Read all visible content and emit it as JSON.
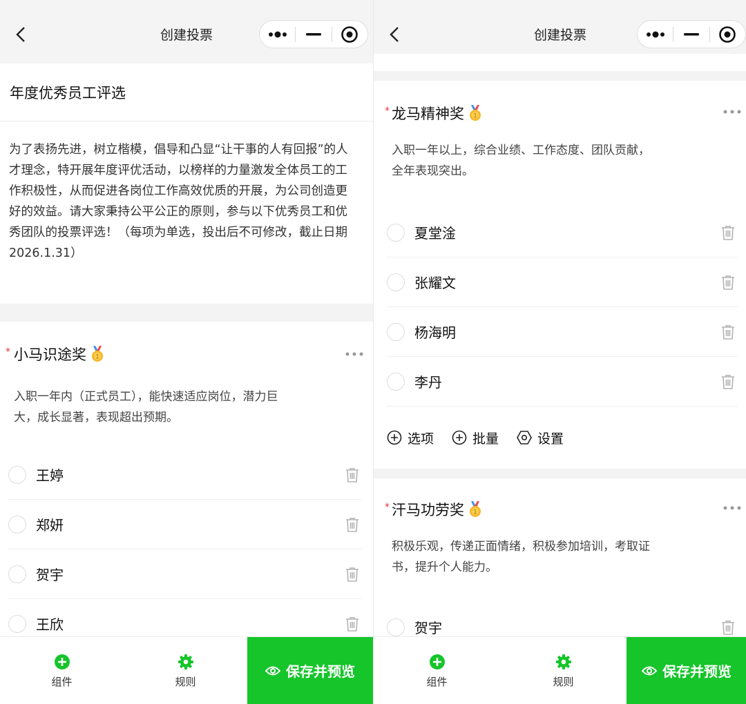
{
  "navbar": {
    "title": "创建投票"
  },
  "vote": {
    "title": "年度优秀员工评选",
    "description": "为了表扬先进，树立楷模，倡导和凸显“让干事的人有回报”的人才理念，特开展年度评优活动，以榜样的力量激发全体员工的工作积极性，从而促进各岗位工作高效优质的开展，为公司创造更好的效益。请大家秉持公平公正的原则，参与以下优秀员工和优秀团队的投票评选！（每项为单选，投出后不可修改，截止日期2026.1.31）"
  },
  "sections": [
    {
      "required_mark": "*",
      "title": "小马识途奖",
      "description": "入职一年内（正式员工），能快速适应岗位，潜力巨大，成长显著，表现超出预期。",
      "options": [
        "王婷",
        "郑妍",
        "贺宇",
        "王欣"
      ]
    },
    {
      "required_mark": "*",
      "title": "龙马精神奖",
      "description": "入职一年以上，综合业绩、工作态度、团队贡献，全年表现突出。",
      "options": [
        "夏堂淦",
        "张耀文",
        "杨海明",
        "李丹"
      ]
    },
    {
      "required_mark": "*",
      "title": "汗马功劳奖",
      "description": "积极乐观，传递正面情绪，积极参加培训，考取证书，提升个人能力。",
      "options": [
        "贺宇"
      ]
    }
  ],
  "actions": {
    "add_option": "选项",
    "batch": "批量",
    "settings": "设置"
  },
  "bottom": {
    "component": "组件",
    "rules": "规则",
    "save_preview": "保存并预览"
  },
  "colors": {
    "primary": "#15c52a",
    "required": "#e0353b"
  }
}
